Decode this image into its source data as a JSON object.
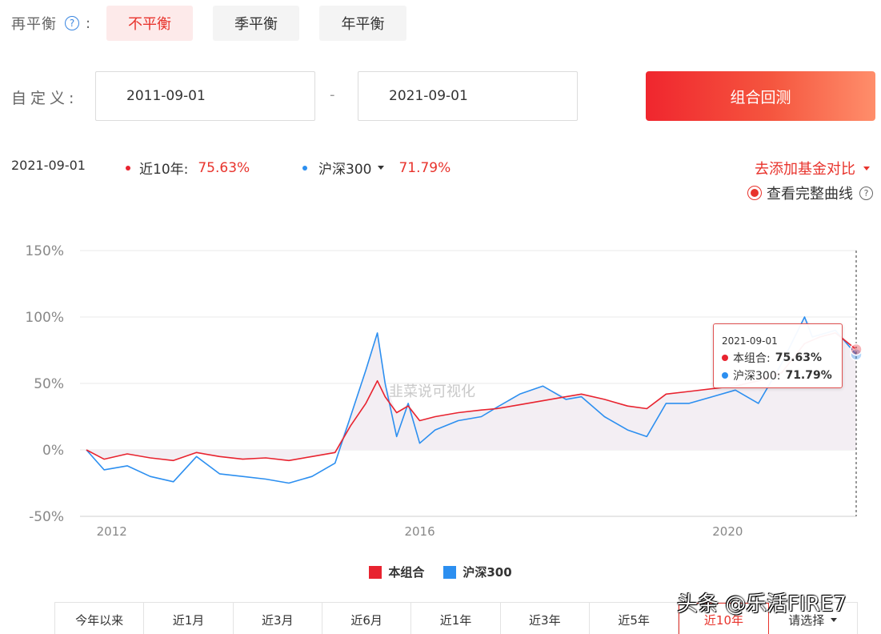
{
  "rebalance": {
    "label": "再平衡",
    "colon": ":",
    "options": [
      "不平衡",
      "季平衡",
      "年平衡"
    ],
    "selected_index": 0
  },
  "custom_range": {
    "label": "自定义:",
    "start": "2011-09-01",
    "separator": "-",
    "end": "2021-09-01",
    "backtest_button": "组合回测"
  },
  "summary": {
    "date": "2021-09-01",
    "series1_label": "近10年:",
    "series1_value": "75.63%",
    "series2_label": "沪深300",
    "series2_value": "71.79%",
    "add_compare": "去添加基金对比",
    "view_full_curve": "查看完整曲线"
  },
  "colors": {
    "accent_red": "#e8332c",
    "portfolio": "#e8232f",
    "benchmark": "#2c8ff0"
  },
  "icons": [
    "help-icon",
    "caret-down-icon",
    "radio-selected-icon"
  ],
  "chart_watermark": "韭菜说可视化",
  "tooltip": {
    "date": "2021-09-01",
    "row1_label": "本组合:",
    "row1_value": "75.63%",
    "row2_label": "沪深300:",
    "row2_value": "71.79%"
  },
  "chart_data": {
    "type": "line",
    "ylim": [
      -50,
      150
    ],
    "y_ticks": [
      "150%",
      "100%",
      "50%",
      "0%",
      "-50%"
    ],
    "y_tick_values": [
      150,
      100,
      50,
      0,
      -50
    ],
    "x_range": [
      2011.67,
      2021.67
    ],
    "x_ticks": [
      "2012",
      "2016",
      "2020"
    ],
    "x_tick_values": [
      2012,
      2016,
      2020
    ],
    "grid": true,
    "legend_position": "bottom",
    "series": [
      {
        "name": "本组合",
        "x": [
          2011.67,
          2011.9,
          2012.2,
          2012.5,
          2012.8,
          2013.1,
          2013.4,
          2013.7,
          2014.0,
          2014.3,
          2014.6,
          2014.9,
          2015.1,
          2015.3,
          2015.45,
          2015.55,
          2015.7,
          2015.85,
          2016.0,
          2016.2,
          2016.5,
          2016.8,
          2017.0,
          2017.3,
          2017.6,
          2017.9,
          2018.1,
          2018.4,
          2018.7,
          2018.95,
          2019.2,
          2019.5,
          2019.8,
          2020.1,
          2020.4,
          2020.7,
          2021.0,
          2021.2,
          2021.4,
          2021.67
        ],
        "values": [
          0,
          -7,
          -3,
          -6,
          -8,
          -2,
          -5,
          -7,
          -6,
          -8,
          -5,
          -2,
          18,
          35,
          52,
          40,
          28,
          33,
          22,
          25,
          28,
          30,
          31,
          34,
          37,
          40,
          42,
          38,
          33,
          31,
          42,
          44,
          46,
          48,
          52,
          58,
          80,
          85,
          88,
          75.63
        ]
      },
      {
        "name": "沪深300",
        "x": [
          2011.67,
          2011.9,
          2012.2,
          2012.5,
          2012.8,
          2013.1,
          2013.4,
          2013.7,
          2014.0,
          2014.3,
          2014.6,
          2014.9,
          2015.1,
          2015.3,
          2015.45,
          2015.55,
          2015.7,
          2015.85,
          2016.0,
          2016.2,
          2016.5,
          2016.8,
          2017.0,
          2017.3,
          2017.6,
          2017.9,
          2018.1,
          2018.4,
          2018.7,
          2018.95,
          2019.2,
          2019.5,
          2019.8,
          2020.1,
          2020.4,
          2020.7,
          2021.0,
          2021.1,
          2021.4,
          2021.67
        ],
        "values": [
          0,
          -15,
          -12,
          -20,
          -24,
          -5,
          -18,
          -20,
          -22,
          -25,
          -20,
          -10,
          25,
          60,
          88,
          50,
          10,
          35,
          5,
          15,
          22,
          25,
          32,
          42,
          48,
          38,
          40,
          25,
          15,
          10,
          35,
          35,
          40,
          45,
          35,
          65,
          100,
          85,
          90,
          71.79
        ]
      }
    ]
  },
  "legend": {
    "portfolio": "本组合",
    "benchmark": "沪深300"
  },
  "period_tabs": [
    "今年以来",
    "近1月",
    "近3月",
    "近6月",
    "近1年",
    "近3年",
    "近5年",
    "近10年",
    "请选择"
  ],
  "period_selected_index": 7,
  "page_watermark": "头条 @乐活FIRE7"
}
